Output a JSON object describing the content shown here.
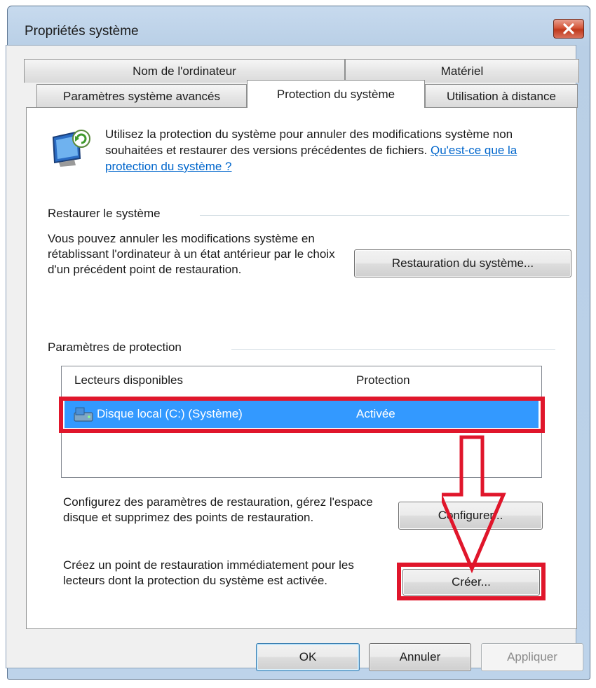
{
  "window": {
    "title": "Propriétés système"
  },
  "tabs": {
    "row1": [
      "Nom de l'ordinateur",
      "Matériel"
    ],
    "row2": [
      "Paramètres système avancés",
      "Protection du système",
      "Utilisation à distance"
    ]
  },
  "intro": {
    "text": "Utilisez la protection du système pour annuler des modifications système non souhaitées et restaurer des versions précédentes de fichiers. ",
    "link": "Qu'est-ce que la protection du système ?"
  },
  "restore": {
    "label": "Restaurer le système",
    "text": "Vous pouvez annuler les modifications système en rétablissant l'ordinateur à un état antérieur par le choix d'un précédent point de restauration.",
    "button": "Restauration du système..."
  },
  "protection": {
    "label": "Paramètres de protection",
    "columns": [
      "Lecteurs disponibles",
      "Protection"
    ],
    "drives": [
      {
        "name": "Disque local (C:) (Système)",
        "status": "Activée"
      }
    ],
    "configure_text": "Configurez des paramètres de restauration, gérez l'espace disque et supprimez des points de restauration.",
    "configure_button": "Configurer...",
    "create_text": "Créez un point de restauration immédiatement pour les lecteurs dont la protection du système est activée.",
    "create_button": "Créer..."
  },
  "footer": {
    "ok": "OK",
    "cancel": "Annuler",
    "apply": "Appliquer"
  },
  "colors": {
    "selection": "#3399ff",
    "highlight_box": "#e0162b",
    "link": "#0066cc"
  }
}
